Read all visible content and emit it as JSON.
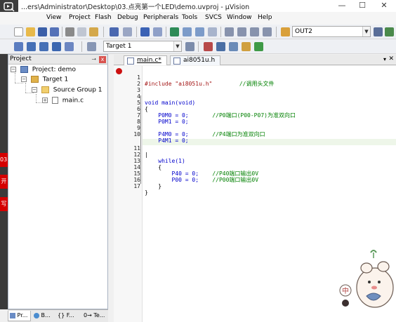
{
  "window": {
    "title": "...ers\\Administrator\\Desktop\\03.点亮第一个LED\\demo.uvproj - µVision",
    "minimize_glyph": "—",
    "maximize_glyph": "☐",
    "close_glyph": "✕"
  },
  "menu": {
    "items": [
      "View",
      "Project",
      "Flash",
      "Debug",
      "Peripherals",
      "Tools",
      "SVCS",
      "Window",
      "Help"
    ]
  },
  "toolbar1": {
    "find_combo_value": "OUT2"
  },
  "toolbar2": {
    "target_combo_value": "Target 1"
  },
  "project_panel": {
    "title": "Project",
    "pin_glyph": "⭢",
    "close_glyph": "x",
    "tree": [
      {
        "label": "Project: demo",
        "level": 0,
        "expander": "−"
      },
      {
        "label": "Target 1",
        "level": 1,
        "expander": "−"
      },
      {
        "label": "Source Group 1",
        "level": 2,
        "expander": "−"
      },
      {
        "label": "main.c",
        "level": 3,
        "expander": "+"
      }
    ]
  },
  "left_strip": {
    "labels": [
      "03.",
      "开",
      "写"
    ]
  },
  "bottom_tabs": [
    {
      "label": "Pr...",
      "icon": "project-icon"
    },
    {
      "label": "B...",
      "icon": "books-icon"
    },
    {
      "label": "{} F...",
      "icon": "functions-icon"
    },
    {
      "label": "0→ Te...",
      "icon": "templates-icon"
    }
  ],
  "editor": {
    "tabs": [
      {
        "label": "main.c*",
        "active": true
      },
      {
        "label": "ai8051u.h",
        "active": false
      }
    ],
    "lines": [
      {
        "num": "1",
        "code": "#include \"ai8051u.h\"",
        "comment": "        //调用头文件"
      },
      {
        "num": "2",
        "code": "",
        "comment": ""
      },
      {
        "num": "3",
        "code": "",
        "comment": ""
      },
      {
        "num": "4",
        "code": "void main(void)",
        "comment": ""
      },
      {
        "num": "5",
        "code": "{",
        "comment": ""
      },
      {
        "num": "6",
        "code": "    P0M0 = 0;",
        "comment": "       //P0端口(P00-P07)为准双向口"
      },
      {
        "num": "7",
        "code": "    P0M1 = 0;",
        "comment": ""
      },
      {
        "num": "8",
        "code": "",
        "comment": ""
      },
      {
        "num": "9",
        "code": "    P4M0 = 0;",
        "comment": "       //P4端口为准双向口"
      },
      {
        "num": "10",
        "code": "    P4M1 = 0;",
        "comment": ""
      },
      {
        "num": "11",
        "code": "|",
        "comment": ""
      },
      {
        "num": "12",
        "code": "    while(1)",
        "comment": ""
      },
      {
        "num": "13",
        "code": "    {",
        "comment": ""
      },
      {
        "num": "14",
        "code": "        P40 = 0;",
        "comment": "    //P40端口输出0V"
      },
      {
        "num": "15",
        "code": "        P00 = 0;",
        "comment": "    //P00端口输出0V"
      },
      {
        "num": "16",
        "code": "    }",
        "comment": ""
      },
      {
        "num": "17",
        "code": "}",
        "comment": ""
      }
    ]
  },
  "sticker": {
    "badge_text": "中"
  },
  "colors": {
    "keyword": "#0000cc",
    "comment": "#008000",
    "string": "#a31515",
    "breakpoint": "#cc1010",
    "accent_red": "#d50000"
  }
}
